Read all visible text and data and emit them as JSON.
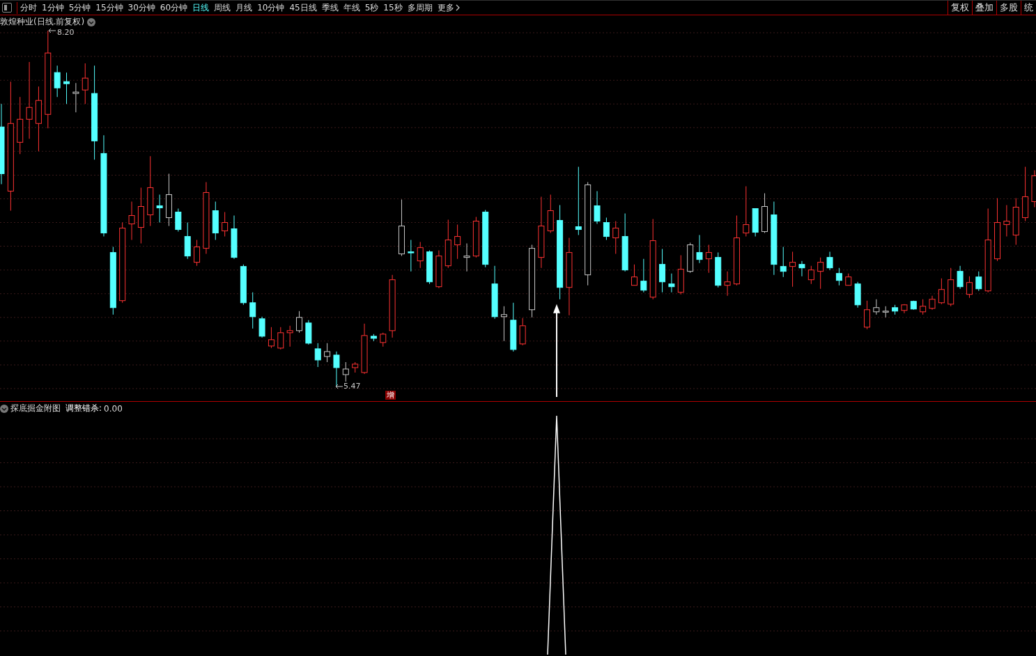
{
  "toolbar": {
    "periods": [
      {
        "label": "分时",
        "selected": false
      },
      {
        "label": "1分钟",
        "selected": false
      },
      {
        "label": "5分钟",
        "selected": false
      },
      {
        "label": "15分钟",
        "selected": false
      },
      {
        "label": "30分钟",
        "selected": false
      },
      {
        "label": "60分钟",
        "selected": false
      },
      {
        "label": "日线",
        "selected": true
      },
      {
        "label": "周线",
        "selected": false
      },
      {
        "label": "月线",
        "selected": false
      },
      {
        "label": "10分钟",
        "selected": false
      },
      {
        "label": "45日线",
        "selected": false
      },
      {
        "label": "季线",
        "selected": false
      },
      {
        "label": "年线",
        "selected": false
      },
      {
        "label": "5秒",
        "selected": false
      },
      {
        "label": "15秒",
        "selected": false
      },
      {
        "label": "多周期",
        "selected": false
      }
    ],
    "more": "更多",
    "buttons": [
      "复权",
      "叠加",
      "多股",
      "统"
    ]
  },
  "main_chart": {
    "title": "敦煌种业(日线.前复权)",
    "high_mark": "8.20",
    "low_mark": "5.47",
    "badge": "增"
  },
  "indicator": {
    "title": "探底掘金附图",
    "reading_label": "调整错杀:",
    "reading_value": "0.00"
  }
}
